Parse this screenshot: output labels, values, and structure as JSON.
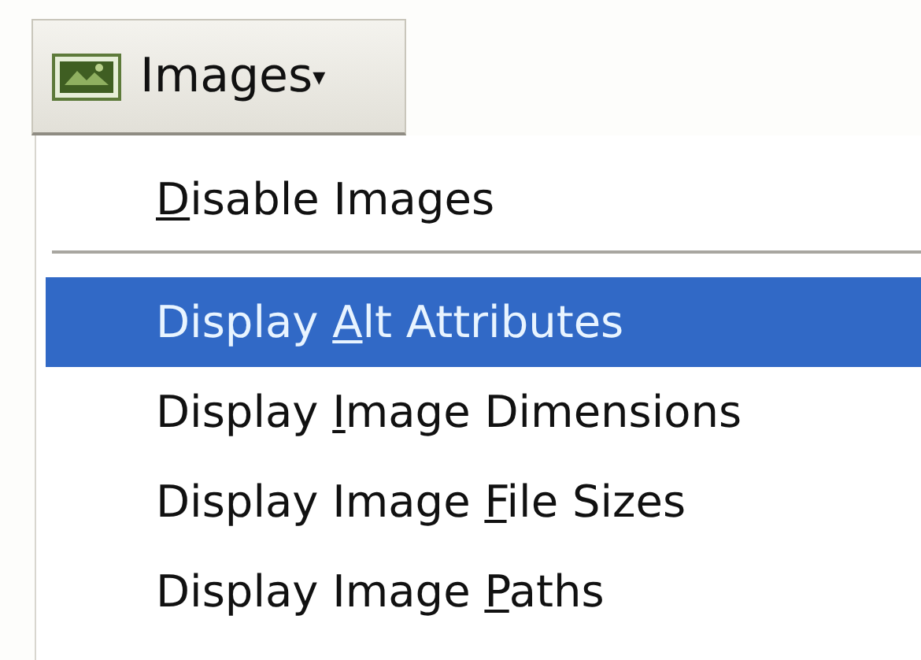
{
  "menu_button": {
    "label": "Images",
    "caret": "▾"
  },
  "menu": {
    "items": [
      {
        "kind": "item",
        "key": "D",
        "after": "isable Images",
        "selected": false
      },
      {
        "kind": "separator"
      },
      {
        "kind": "item",
        "before": "Display ",
        "key": "A",
        "after": "lt Attributes",
        "selected": true
      },
      {
        "kind": "item",
        "before": "Display ",
        "key": "I",
        "after": "mage Dimensions",
        "selected": false
      },
      {
        "kind": "item",
        "before": "Display Image ",
        "key": "F",
        "after": "ile Sizes",
        "selected": false
      },
      {
        "kind": "item",
        "before": "Display Image ",
        "key": "P",
        "after": "aths",
        "selected": false
      }
    ]
  }
}
